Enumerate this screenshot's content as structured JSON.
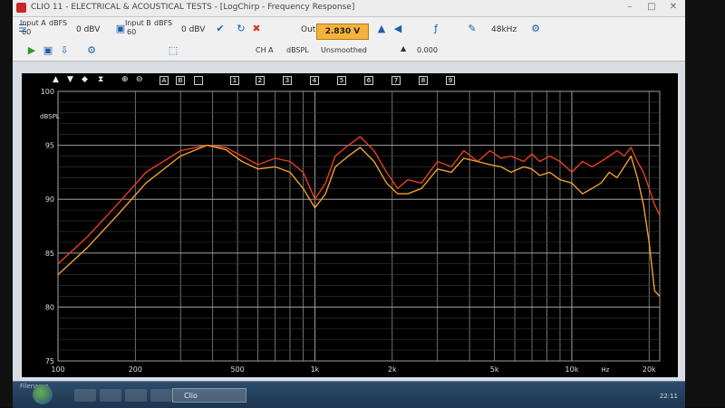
{
  "window": {
    "title": "CLIO 11 - ELECTRICAL & ACOUSTICAL TESTS - [LogChirp - Frequency Response]"
  },
  "toolbar": {
    "input_a_label": "Input A",
    "input_a_value": "60",
    "input_a_unit": "dBFS",
    "input_a_level": "0 dBV",
    "input_b_label": "Input B",
    "input_b_value": "60",
    "input_b_unit": "dBFS",
    "input_b_level": "0 dBV",
    "out_label": "Out",
    "out_value": "2.830 V",
    "sample_rate": "48kHz",
    "channel": "CH A",
    "unit": "dBSPL",
    "smoothing": "Unsmoothed",
    "offset_value": "0.000"
  },
  "graph_buttons": [
    "1",
    "2",
    "3",
    "4",
    "5",
    "6",
    "7",
    "8",
    "9"
  ],
  "taskbar": {
    "filename_label": "Filename",
    "app_item": "Clio",
    "clock": "22:11"
  },
  "chart_data": {
    "type": "line",
    "ylabel": "dBSPL",
    "xlabel": "Hz",
    "x_scale": "log",
    "xlim": [
      100,
      22000
    ],
    "ylim": [
      75,
      100
    ],
    "y_ticks": [
      75,
      80,
      85,
      90,
      95,
      100
    ],
    "x_tick_labels": [
      "100",
      "200",
      "500",
      "1k",
      "2k",
      "5k",
      "10k",
      "20k"
    ],
    "x_tick_values": [
      100,
      200,
      500,
      1000,
      2000,
      5000,
      10000,
      20000
    ],
    "x_unit_label": "Hz",
    "grid": true,
    "series": [
      {
        "color": "#e8401c",
        "x": [
          100,
          130,
          170,
          220,
          300,
          380,
          450,
          520,
          600,
          700,
          800,
          900,
          1000,
          1100,
          1200,
          1350,
          1500,
          1700,
          1900,
          2100,
          2300,
          2600,
          3000,
          3400,
          3800,
          4300,
          4800,
          5300,
          5800,
          6500,
          7000,
          7500,
          8200,
          9000,
          10000,
          11000,
          12000,
          13000,
          14000,
          15000,
          16000,
          17000,
          18000,
          19000,
          20000,
          21000,
          22000
        ],
        "y": [
          84.0,
          86.5,
          89.5,
          92.5,
          94.5,
          95.0,
          94.8,
          94.0,
          93.2,
          93.8,
          93.5,
          92.5,
          90.0,
          91.5,
          94.0,
          95.0,
          95.8,
          94.5,
          92.5,
          91.0,
          91.8,
          91.5,
          93.5,
          93.0,
          94.5,
          93.5,
          94.5,
          93.8,
          94.0,
          93.5,
          94.2,
          93.5,
          94.0,
          93.5,
          92.5,
          93.5,
          93.0,
          93.5,
          94.0,
          94.5,
          94.0,
          94.8,
          93.5,
          92.5,
          91.0,
          89.5,
          88.5
        ]
      },
      {
        "color": "#f0a030",
        "x": [
          100,
          130,
          170,
          220,
          300,
          380,
          450,
          520,
          600,
          700,
          800,
          900,
          1000,
          1100,
          1200,
          1350,
          1500,
          1700,
          1900,
          2100,
          2300,
          2600,
          3000,
          3400,
          3800,
          4300,
          4800,
          5300,
          5800,
          6500,
          7000,
          7500,
          8200,
          9000,
          10000,
          11000,
          12000,
          13000,
          14000,
          15000,
          16000,
          17000,
          18000,
          19000,
          20000,
          21000,
          22000
        ],
        "y": [
          83.0,
          85.5,
          88.5,
          91.5,
          94.0,
          95.0,
          94.6,
          93.5,
          92.8,
          93.0,
          92.5,
          91.0,
          89.2,
          90.5,
          93.0,
          94.0,
          94.8,
          93.5,
          91.5,
          90.5,
          90.5,
          91.0,
          92.8,
          92.5,
          93.8,
          93.5,
          93.2,
          93.0,
          92.5,
          93.0,
          92.8,
          92.2,
          92.5,
          91.8,
          91.5,
          90.5,
          91.0,
          91.5,
          92.5,
          92.0,
          93.0,
          94.0,
          92.0,
          89.5,
          86.0,
          81.5,
          81.0
        ]
      }
    ]
  }
}
